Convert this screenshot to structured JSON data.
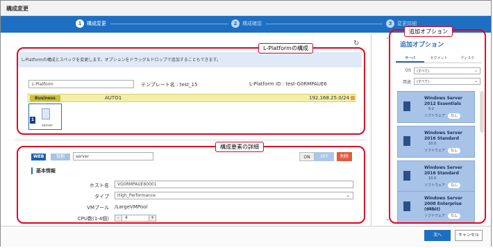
{
  "window": {
    "title": "構成変更"
  },
  "steps": [
    {
      "num": "1",
      "label": "構成変更"
    },
    {
      "num": "2",
      "label": "構成確認"
    },
    {
      "num": "3",
      "label": "変更詳細"
    }
  ],
  "lplatform": {
    "info": "L-Platformの構成とスペックを変更します。オプションをドラッグ＆ドロップで追加することもできます。",
    "name_value": "L-Platform",
    "template": "テンプレート名 : test_15",
    "id": "L-Platform ID : test-G0RMPAUE6",
    "segment": {
      "name": "Business",
      "mode": "AUTO1",
      "ip": "192.168.25.0/24"
    },
    "server": {
      "index": "1",
      "label": "server"
    }
  },
  "detail": {
    "tag": "WEB",
    "role": "役割",
    "server_name": "server",
    "on": "ON",
    "off": "OFF",
    "delete": "削除",
    "section": "基本情報",
    "fields": {
      "hostname_label": "ホスト名",
      "hostname_value": "VG0RMPAUE60001",
      "type_label": "タイプ",
      "type_value": "High_Performance",
      "pool_label": "VMプール",
      "pool_value": "/LargeVMPool",
      "cpu_label": "CPU数(1-4個)",
      "cpu_minus": "-",
      "cpu_value": "4",
      "cpu_plus": "+"
    }
  },
  "options": {
    "title": "追加オプション",
    "tabs": [
      "サーバ",
      "セグメント",
      "ディスク"
    ],
    "os_label": "OS",
    "os_value": "(すべて)",
    "use_label": "用途",
    "use_value": "(すべて)",
    "cards": [
      {
        "name": "Windows Server 2012 Essentials",
        "version": "6.2",
        "sw_label": "ソフトウェア",
        "sw_value": "なし"
      },
      {
        "name": "Windows Server 2016 Standard",
        "version": "10.0",
        "sw_label": "ソフトウェア",
        "sw_value": "なし"
      },
      {
        "name": "Windows Server 2016 Standard",
        "version": "10.0",
        "sw_label": "ソフトウェア",
        "sw_value": "なし"
      },
      {
        "name": "Windows Server 2008 Enterprise (64bit)",
        "version": "6.0",
        "sw_label": "ソフトウェア",
        "sw_value": "なし"
      }
    ]
  },
  "footer": {
    "next": "次へ",
    "cancel": "キャンセル"
  },
  "annotations": {
    "lplatform": "L-Platformの構成",
    "detail": "構成要素の詳細",
    "options": "追加オプション"
  },
  "colors": {
    "accent": "#1e6fc2",
    "annotation": "#e6001e",
    "segment": "#f3efa4",
    "card": "#a7c3e7"
  }
}
